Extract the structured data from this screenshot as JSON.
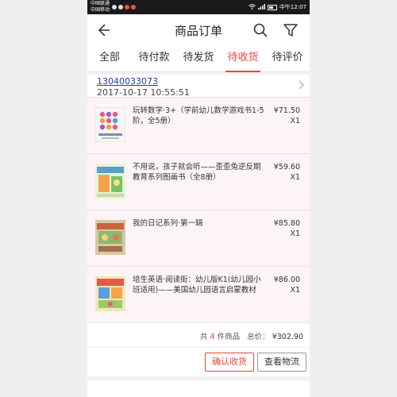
{
  "status_bar": {
    "carrier_1": "中国联通",
    "carrier_2": "中国移动",
    "time": "中午12:07"
  },
  "header": {
    "title": "商品订单",
    "back_icon": "back-arrow-icon",
    "search_icon": "search-icon",
    "filter_icon": "filter-icon"
  },
  "tabs": [
    {
      "label": "全部",
      "active": false
    },
    {
      "label": "待付款",
      "active": false
    },
    {
      "label": "待发货",
      "active": false
    },
    {
      "label": "待收货",
      "active": true
    },
    {
      "label": "待评价",
      "active": false
    }
  ],
  "order": {
    "phone": "13040033073",
    "time": "2017-10-17 10:55:51",
    "items": [
      {
        "name": "玩转数学·3+（学前幼儿数学游戏书1-5阶，全5册）",
        "price": "¥71.50",
        "qty": "X1"
      },
      {
        "name": "不用说，孩子就会听——歪歪兔逆反期教育系列图画书（全8册）",
        "price": "¥59.60",
        "qty": "X1"
      },
      {
        "name": "我的日记系列·第一辑",
        "price": "¥85.80",
        "qty": "X1"
      },
      {
        "name": "培生英语·阅读街：幼儿版K1(幼儿园小班适用)——美国幼儿园语言启蒙教材",
        "price": "¥86.00",
        "qty": "X1"
      }
    ],
    "summary_prefix": "共",
    "item_count": "4",
    "summary_suffix": "件商品",
    "total_label": "总价：",
    "total": "¥302.90",
    "confirm_label": "确认收货",
    "logistics_label": "查看物流"
  },
  "colors": {
    "accent": "#e9463a",
    "link": "#1f3fa0"
  }
}
